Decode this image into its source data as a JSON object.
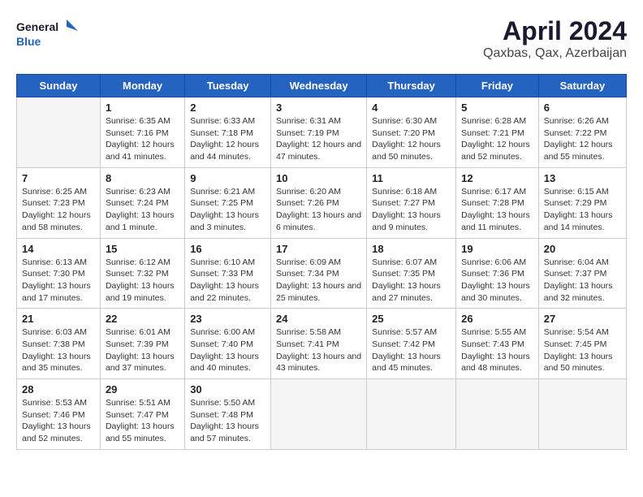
{
  "logo": {
    "line1": "General",
    "line2": "Blue"
  },
  "title": "April 2024",
  "subtitle": "Qaxbas, Qax, Azerbaijan",
  "weekdays": [
    "Sunday",
    "Monday",
    "Tuesday",
    "Wednesday",
    "Thursday",
    "Friday",
    "Saturday"
  ],
  "weeks": [
    [
      {
        "day": "",
        "empty": true
      },
      {
        "day": "1",
        "sunrise": "6:35 AM",
        "sunset": "7:16 PM",
        "daylight": "12 hours and 41 minutes."
      },
      {
        "day": "2",
        "sunrise": "6:33 AM",
        "sunset": "7:18 PM",
        "daylight": "12 hours and 44 minutes."
      },
      {
        "day": "3",
        "sunrise": "6:31 AM",
        "sunset": "7:19 PM",
        "daylight": "12 hours and 47 minutes."
      },
      {
        "day": "4",
        "sunrise": "6:30 AM",
        "sunset": "7:20 PM",
        "daylight": "12 hours and 50 minutes."
      },
      {
        "day": "5",
        "sunrise": "6:28 AM",
        "sunset": "7:21 PM",
        "daylight": "12 hours and 52 minutes."
      },
      {
        "day": "6",
        "sunrise": "6:26 AM",
        "sunset": "7:22 PM",
        "daylight": "12 hours and 55 minutes."
      }
    ],
    [
      {
        "day": "7",
        "sunrise": "6:25 AM",
        "sunset": "7:23 PM",
        "daylight": "12 hours and 58 minutes."
      },
      {
        "day": "8",
        "sunrise": "6:23 AM",
        "sunset": "7:24 PM",
        "daylight": "13 hours and 1 minute."
      },
      {
        "day": "9",
        "sunrise": "6:21 AM",
        "sunset": "7:25 PM",
        "daylight": "13 hours and 3 minutes."
      },
      {
        "day": "10",
        "sunrise": "6:20 AM",
        "sunset": "7:26 PM",
        "daylight": "13 hours and 6 minutes."
      },
      {
        "day": "11",
        "sunrise": "6:18 AM",
        "sunset": "7:27 PM",
        "daylight": "13 hours and 9 minutes."
      },
      {
        "day": "12",
        "sunrise": "6:17 AM",
        "sunset": "7:28 PM",
        "daylight": "13 hours and 11 minutes."
      },
      {
        "day": "13",
        "sunrise": "6:15 AM",
        "sunset": "7:29 PM",
        "daylight": "13 hours and 14 minutes."
      }
    ],
    [
      {
        "day": "14",
        "sunrise": "6:13 AM",
        "sunset": "7:30 PM",
        "daylight": "13 hours and 17 minutes."
      },
      {
        "day": "15",
        "sunrise": "6:12 AM",
        "sunset": "7:32 PM",
        "daylight": "13 hours and 19 minutes."
      },
      {
        "day": "16",
        "sunrise": "6:10 AM",
        "sunset": "7:33 PM",
        "daylight": "13 hours and 22 minutes."
      },
      {
        "day": "17",
        "sunrise": "6:09 AM",
        "sunset": "7:34 PM",
        "daylight": "13 hours and 25 minutes."
      },
      {
        "day": "18",
        "sunrise": "6:07 AM",
        "sunset": "7:35 PM",
        "daylight": "13 hours and 27 minutes."
      },
      {
        "day": "19",
        "sunrise": "6:06 AM",
        "sunset": "7:36 PM",
        "daylight": "13 hours and 30 minutes."
      },
      {
        "day": "20",
        "sunrise": "6:04 AM",
        "sunset": "7:37 PM",
        "daylight": "13 hours and 32 minutes."
      }
    ],
    [
      {
        "day": "21",
        "sunrise": "6:03 AM",
        "sunset": "7:38 PM",
        "daylight": "13 hours and 35 minutes."
      },
      {
        "day": "22",
        "sunrise": "6:01 AM",
        "sunset": "7:39 PM",
        "daylight": "13 hours and 37 minutes."
      },
      {
        "day": "23",
        "sunrise": "6:00 AM",
        "sunset": "7:40 PM",
        "daylight": "13 hours and 40 minutes."
      },
      {
        "day": "24",
        "sunrise": "5:58 AM",
        "sunset": "7:41 PM",
        "daylight": "13 hours and 43 minutes."
      },
      {
        "day": "25",
        "sunrise": "5:57 AM",
        "sunset": "7:42 PM",
        "daylight": "13 hours and 45 minutes."
      },
      {
        "day": "26",
        "sunrise": "5:55 AM",
        "sunset": "7:43 PM",
        "daylight": "13 hours and 48 minutes."
      },
      {
        "day": "27",
        "sunrise": "5:54 AM",
        "sunset": "7:45 PM",
        "daylight": "13 hours and 50 minutes."
      }
    ],
    [
      {
        "day": "28",
        "sunrise": "5:53 AM",
        "sunset": "7:46 PM",
        "daylight": "13 hours and 52 minutes."
      },
      {
        "day": "29",
        "sunrise": "5:51 AM",
        "sunset": "7:47 PM",
        "daylight": "13 hours and 55 minutes."
      },
      {
        "day": "30",
        "sunrise": "5:50 AM",
        "sunset": "7:48 PM",
        "daylight": "13 hours and 57 minutes."
      },
      {
        "day": "",
        "empty": true
      },
      {
        "day": "",
        "empty": true
      },
      {
        "day": "",
        "empty": true
      },
      {
        "day": "",
        "empty": true
      }
    ]
  ],
  "labels": {
    "sunrise": "Sunrise:",
    "sunset": "Sunset:",
    "daylight": "Daylight:"
  }
}
